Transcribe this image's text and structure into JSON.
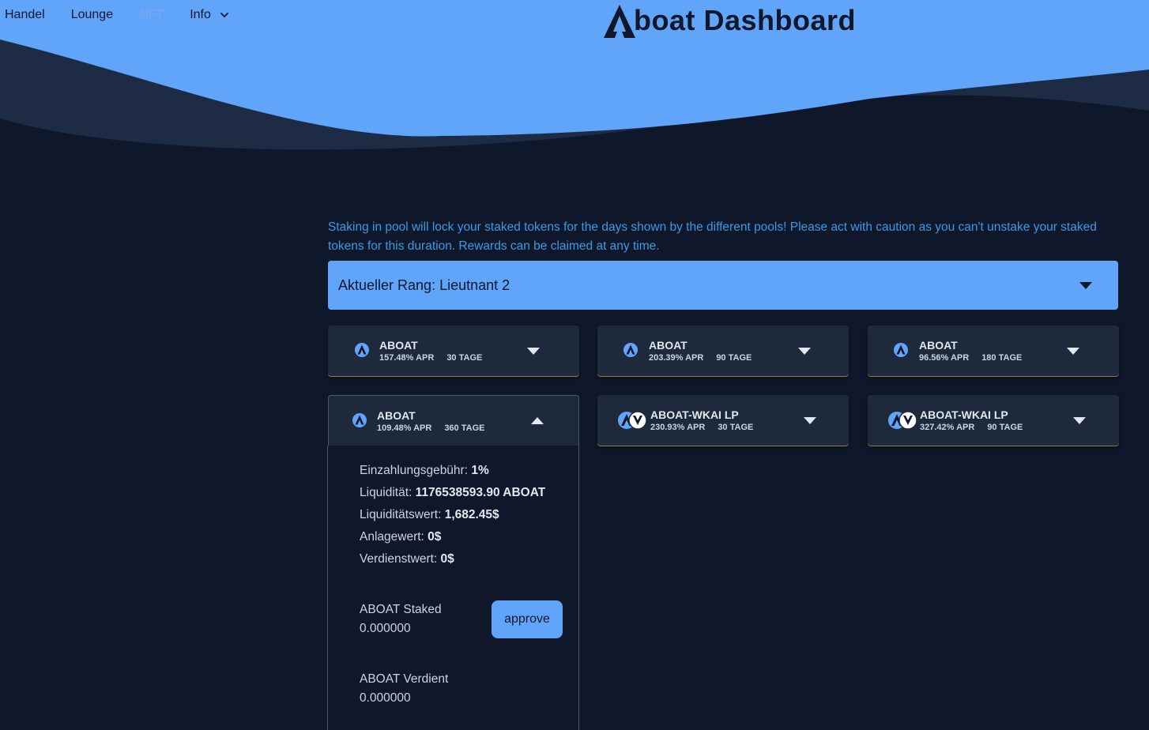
{
  "nav": {
    "items": [
      "Handel",
      "Lounge",
      "NFT"
    ],
    "info_label": "Info"
  },
  "header": {
    "title_rest": "boat Dashboard"
  },
  "notice": "Staking in pool will lock your staked tokens for the days shown by the different pools! Please act with caution as you can't unstake your staked tokens for this duration. Rewards can be claimed at any time.",
  "rank": {
    "label": "Aktueller Rang: Lieutnant 2"
  },
  "pools": [
    {
      "name": "ABOAT",
      "apr": "157.48% APR",
      "duration": "30 TAGE",
      "expanded": false,
      "icon": "aboat-token-icon"
    },
    {
      "name": "ABOAT",
      "apr": "203.39% APR",
      "duration": "90 TAGE",
      "expanded": false,
      "icon": "aboat-token-icon"
    },
    {
      "name": "ABOAT",
      "apr": "96.56% APR",
      "duration": "180 TAGE",
      "expanded": false,
      "icon": "aboat-token-icon"
    },
    {
      "name": "ABOAT",
      "apr": "109.48% APR",
      "duration": "360 TAGE",
      "expanded": true,
      "icon": "aboat-token-icon"
    },
    {
      "name": "ABOAT-WKAI LP",
      "apr": "230.93% APR",
      "duration": "30 TAGE",
      "expanded": false,
      "icon": "aboat-wkai-lp-icon"
    },
    {
      "name": "ABOAT-WKAI LP",
      "apr": "327.42% APR",
      "duration": "90 TAGE",
      "expanded": false,
      "icon": "aboat-wkai-lp-icon"
    }
  ],
  "details": {
    "fee_label": "Einzahlungsgebühr:",
    "fee_value": "1%",
    "liquidity_label": "Liquidität:",
    "liquidity_value": "1176538593.90 ABOAT",
    "liquidity_value_label": "Liquiditätswert:",
    "liquidity_value_value": "1,682.45$",
    "investment_label": "Anlagewert:",
    "investment_value": "0$",
    "earnings_label": "Verdienstwert:",
    "earnings_value": "0$",
    "staked_label": "ABOAT Staked",
    "staked_value": "0.000000",
    "approve_label": "approve",
    "earned_label": "ABOAT Verdient",
    "earned_value": "0.000000"
  },
  "colors": {
    "background": "#0f172a",
    "accent": "#60a5fa",
    "card": "#1e293b",
    "notice_text": "#3b9ae6",
    "card_border": "#9a7a3a"
  }
}
